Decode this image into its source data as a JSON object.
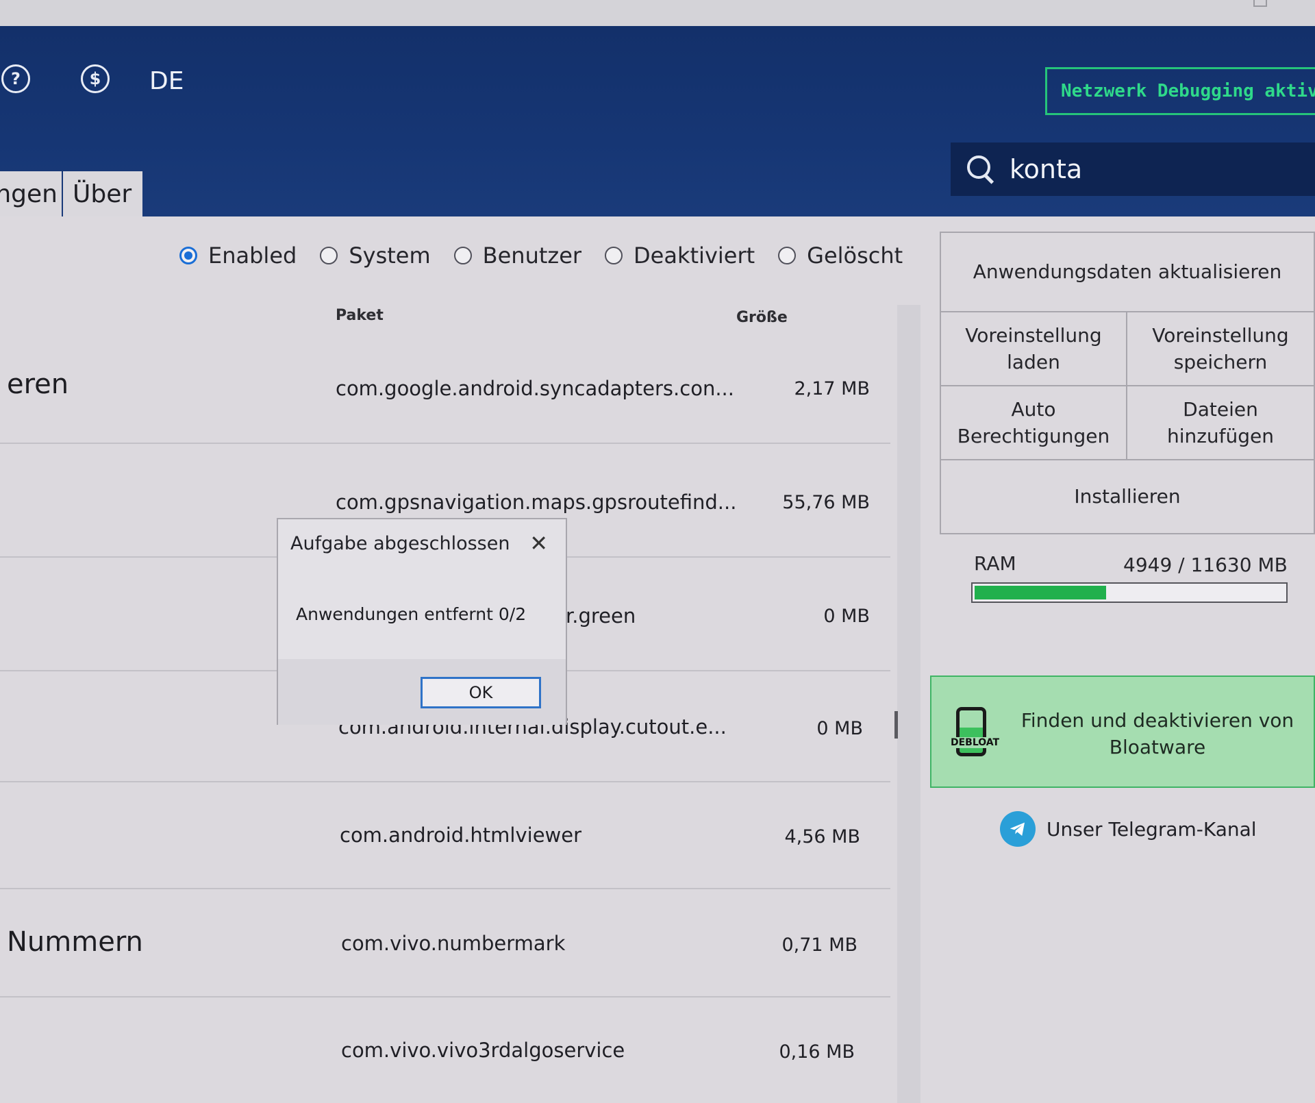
{
  "header": {
    "help_icon": "?",
    "donate_icon": "$",
    "language": "DE",
    "network_debug_label": "Netzwerk Debugging aktiviere"
  },
  "search": {
    "value": "konta"
  },
  "tabs": [
    {
      "label": "ngen"
    },
    {
      "label": "Über"
    }
  ],
  "filters": [
    {
      "label": "Enabled",
      "selected": true
    },
    {
      "label": "System",
      "selected": false
    },
    {
      "label": "Benutzer",
      "selected": false
    },
    {
      "label": "Deaktiviert",
      "selected": false
    },
    {
      "label": "Gelöscht",
      "selected": false
    }
  ],
  "columns": {
    "package": "Paket",
    "size": "Größe"
  },
  "rows": [
    {
      "label": "eren",
      "package": "com.google.android.syncadapters.con...",
      "size": "2,17  MB"
    },
    {
      "label": "",
      "package": "com.gpsnavigation.maps.gpsroutefind...",
      "size": "55,76  MB"
    },
    {
      "label": "",
      "package": "r.green",
      "size": "0  MB"
    },
    {
      "label": "",
      "package": "com.android.internal.display.cutout.e...",
      "size": "0  MB"
    },
    {
      "label": "",
      "package": "com.android.htmlviewer",
      "size": "4,56  MB"
    },
    {
      "label": "Nummern",
      "package": "com.vivo.numbermark",
      "size": "0,71  MB"
    },
    {
      "label": "",
      "package": "com.vivo.vivo3rdalgoservice",
      "size": "0,16  MB"
    }
  ],
  "side": {
    "refresh_label": "Anwendungsdaten aktualisieren",
    "load_preset_label": "Voreinstellung laden",
    "save_preset_label": "Voreinstellung speichern",
    "auto_permissions_label": "Auto Berechtigungen",
    "add_files_label": "Dateien hinzufügen",
    "install_label": "Installieren",
    "ram_label": "RAM",
    "ram_value": "4949 / 11630 MB",
    "ram_used": 4949,
    "ram_total": 11630,
    "debloat_text": "Finden und deaktivieren von Bloatware",
    "debloat_icon_tag": "DEBLOAT",
    "telegram_label": "Unser Telegram-Kanal"
  },
  "dialog": {
    "title": "Aufgabe abgeschlossen",
    "message": "Anwendungen entfernt 0/2",
    "ok_label": "OK"
  },
  "colors": {
    "header": "#163674",
    "accent_green": "#2fd98a",
    "ram_fill": "#21b04d",
    "debloat_bg": "#a5ddb0",
    "radio_selected": "#1a6ed6"
  }
}
